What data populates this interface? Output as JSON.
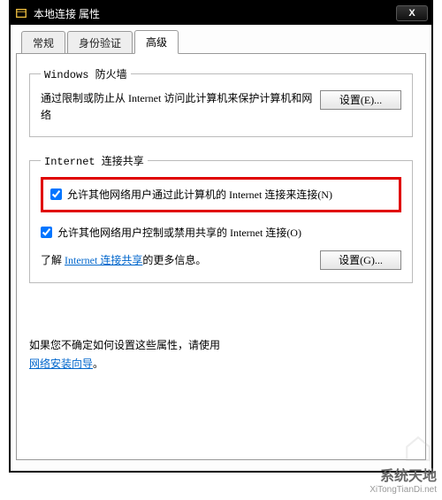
{
  "titlebar": {
    "title": "本地连接 属性",
    "close": "X"
  },
  "tabs": {
    "general": "常规",
    "auth": "身份验证",
    "advanced": "高级"
  },
  "firewall": {
    "legend": "Windows 防火墙",
    "desc": "通过限制或防止从 Internet 访问此计算机来保护计算机和网络",
    "settings_btn": "设置(E)..."
  },
  "ics": {
    "legend": "Internet 连接共享",
    "allow_connect": "允许其他网络用户通过此计算机的 Internet 连接来连接(N)",
    "allow_control": "允许其他网络用户控制或禁用共享的 Internet 连接(O)",
    "learn_prefix": "了解 ",
    "learn_link": "Internet 连接共享",
    "learn_suffix": "的更多信息。",
    "settings_btn": "设置(G)..."
  },
  "footer": {
    "line1": "如果您不确定如何设置这些属性，请使用",
    "wizard_link": "网络安装向导",
    "suffix": "。"
  },
  "watermark": {
    "line1": "系统天地",
    "line2": "XiTongTianDi.net"
  }
}
